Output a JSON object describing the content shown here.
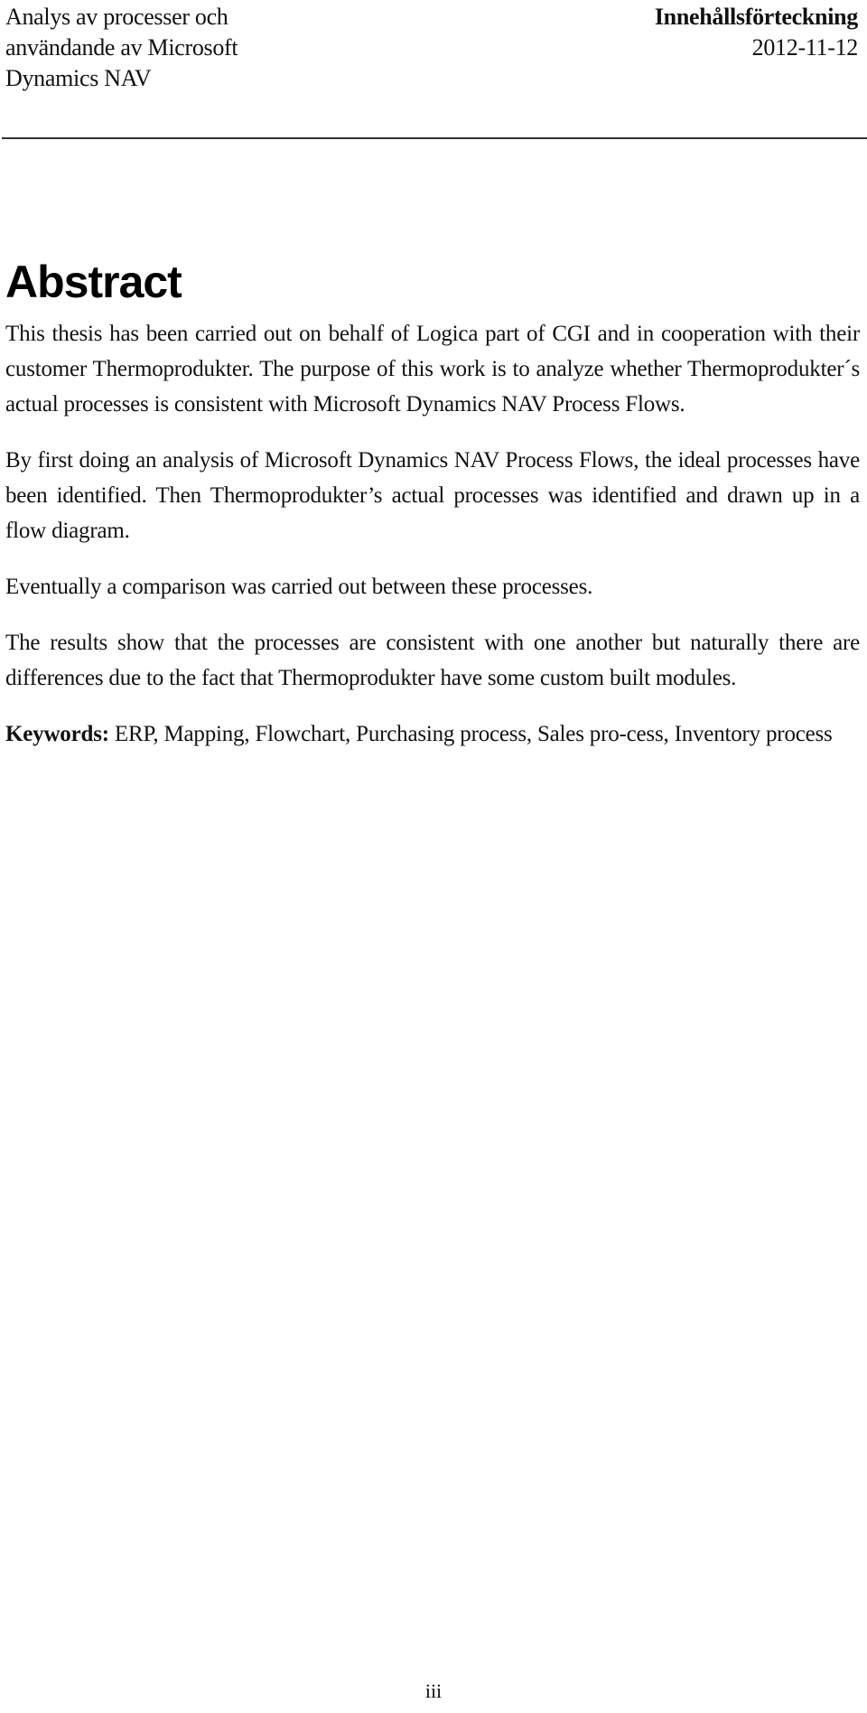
{
  "header": {
    "document_title_lines": [
      "Analys av processer och",
      "användande av Microsoft",
      "Dynamics NAV"
    ],
    "section_name": "Innehållsförteckning",
    "date": "2012-11-12"
  },
  "abstract": {
    "heading": "Abstract",
    "paragraphs": [
      "This thesis has been carried out on behalf of Logica part of CGI and in cooperation with their customer Thermoprodukter. The purpose of this work is to analyze whether Thermoprodukter´s actual processes is consistent with Microsoft Dynamics NAV Process Flows.",
      "By first doing an analysis of Microsoft Dynamics NAV Process Flows, the ideal processes have been identified. Then Thermoprodukter’s actual processes was identified and drawn up in a flow diagram.",
      "Eventually a comparison was carried out between these processes.",
      "The results show that the processes are consistent with one another but naturally there are differences due to the fact that Thermoprodukter have some custom built modules."
    ],
    "keywords_label": "Keywords:",
    "keywords_text": " ERP, Mapping, Flowchart, Purchasing process, Sales pro-cess, Inventory process"
  },
  "footer": {
    "page_number": "iii"
  }
}
